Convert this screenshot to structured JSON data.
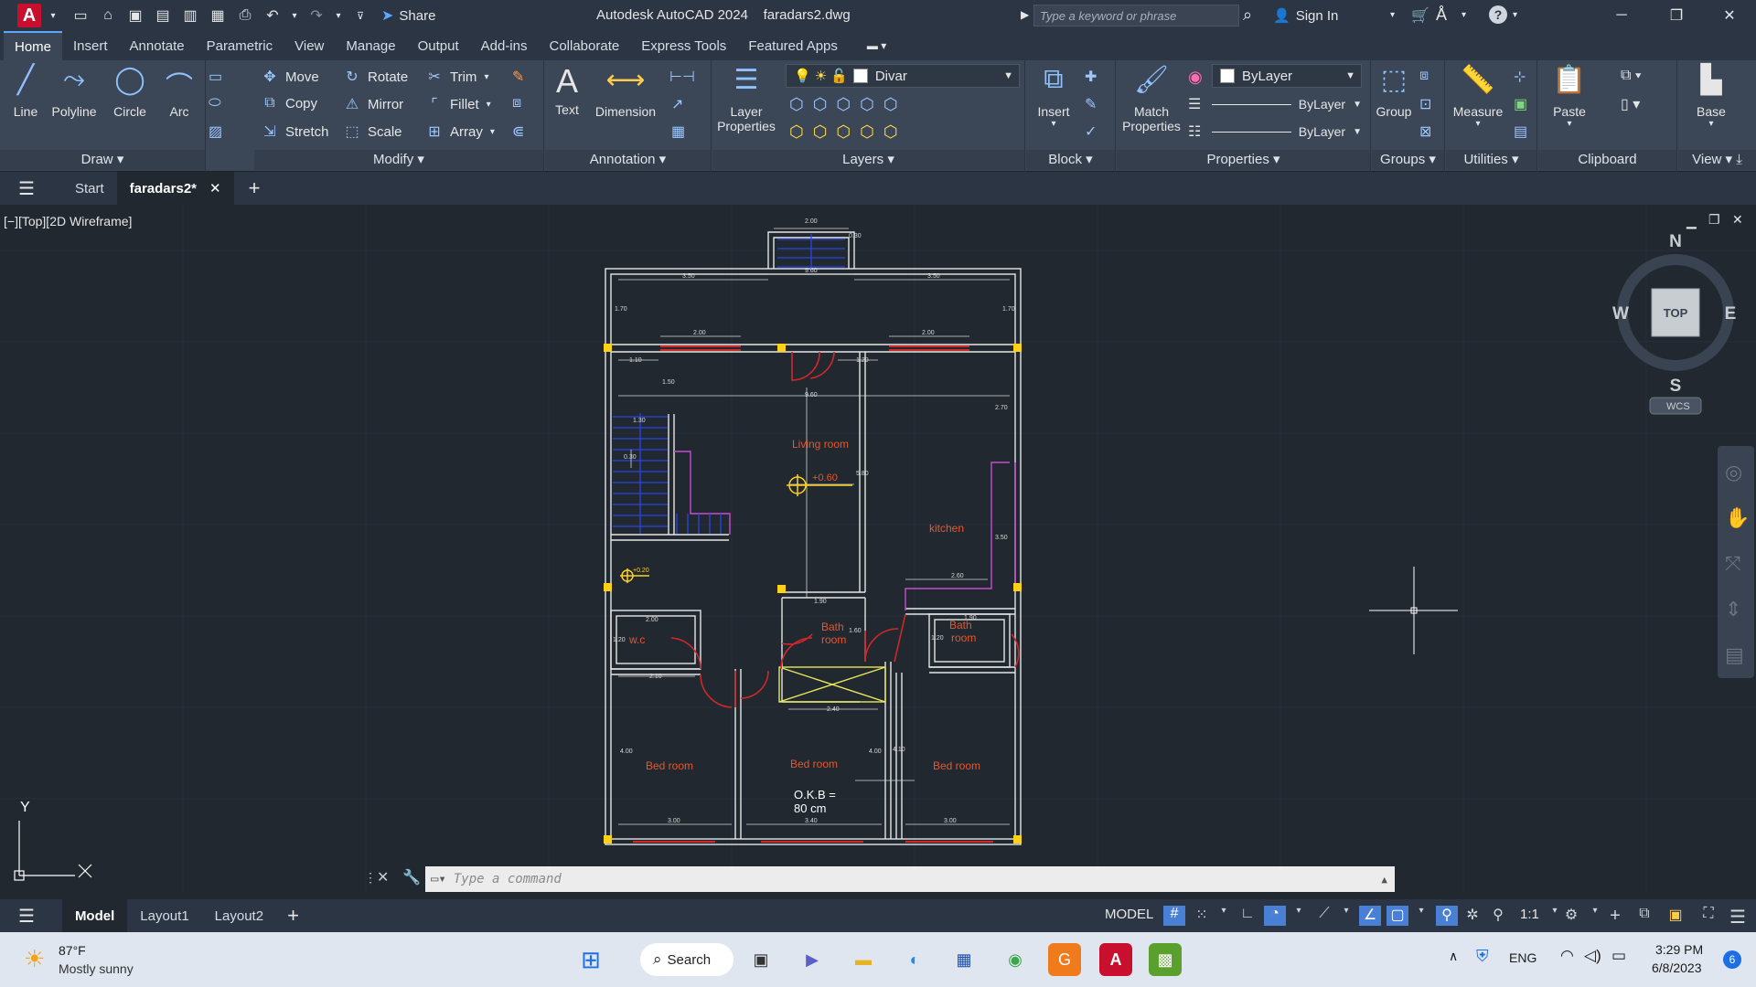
{
  "app": {
    "logo_letter": "A",
    "title": "Autodesk AutoCAD 2024",
    "filename": "faradars2.dwg",
    "share_label": "Share",
    "search_placeholder": "Type a keyword or phrase",
    "sign_in": "Sign In"
  },
  "menu_tabs": [
    "Home",
    "Insert",
    "Annotate",
    "Parametric",
    "View",
    "Manage",
    "Output",
    "Add-ins",
    "Collaborate",
    "Express Tools",
    "Featured Apps"
  ],
  "ribbon": {
    "draw": {
      "title": "Draw",
      "line": "Line",
      "polyline": "Polyline",
      "circle": "Circle",
      "arc": "Arc"
    },
    "modify": {
      "title": "Modify",
      "move": "Move",
      "rotate": "Rotate",
      "trim": "Trim",
      "copy": "Copy",
      "mirror": "Mirror",
      "fillet": "Fillet",
      "stretch": "Stretch",
      "scale": "Scale",
      "array": "Array"
    },
    "annotation": {
      "title": "Annotation",
      "text": "Text",
      "dimension": "Dimension"
    },
    "layers": {
      "title": "Layers",
      "layer_properties_1": "Layer",
      "layer_properties_2": "Properties",
      "current_layer": "Divar"
    },
    "block": {
      "title": "Block",
      "insert": "Insert"
    },
    "properties": {
      "title": "Properties",
      "match_1": "Match",
      "match_2": "Properties",
      "color": "ByLayer",
      "linetype": "ByLayer",
      "lineweight": "ByLayer"
    },
    "groups": {
      "title": "Groups",
      "group": "Group"
    },
    "utilities": {
      "title": "Utilities",
      "measure": "Measure"
    },
    "clipboard": {
      "title": "Clipboard",
      "paste": "Paste"
    },
    "view": {
      "title": "View",
      "base": "Base"
    }
  },
  "file_tabs": {
    "start": "Start",
    "active": "faradars2*"
  },
  "viewport": {
    "label": "[−][Top][2D Wireframe]",
    "viewcube": {
      "n": "N",
      "s": "S",
      "e": "E",
      "w": "W",
      "top": "TOP",
      "wcs": "WCS"
    },
    "ucs_y": "Y"
  },
  "drawing": {
    "rooms": {
      "living": "Living room",
      "kitchen": "kitchen",
      "bath1_a": "Bath",
      "bath1_b": "room",
      "bath2_a": "Bath",
      "bath2_b": "room",
      "wc": "w.c",
      "bed1": "Bed room",
      "bed2": "Bed room",
      "bed3": "Bed room"
    },
    "elevation": "+0.60",
    "elevation_small": "+0.20",
    "okb_1": "O.K.B =",
    "okb_2": "80 cm",
    "dims": {
      "top": "2.00",
      "top_r": "0.30",
      "d350a": "3.50",
      "d960a": "9.60",
      "d350b": "3.50",
      "d170a": "1.70",
      "d170b": "1.70",
      "d200a": "2.00",
      "d200b": "2.00",
      "d110": "1.10",
      "d120": "1.20",
      "d150": "1.50",
      "d960b": "9.60",
      "d270": "2.70",
      "d130": "1.30",
      "d030": "0.30",
      "d580": "5.80",
      "d350c": "3.50",
      "d260": "2.60",
      "d200c": "2.00",
      "d120b": "1.20",
      "d190a": "1.90",
      "d190b": "1.90",
      "d160": "1.60",
      "d120c": "1.20",
      "d210": "2.10",
      "d240": "2.40",
      "d400a": "4.00",
      "d400b": "4.00",
      "d410": "4.10",
      "d300a": "3.00",
      "d340": "3.40",
      "d300b": "3.00"
    }
  },
  "command": {
    "placeholder": "Type a command"
  },
  "layout_tabs": [
    "Model",
    "Layout1",
    "Layout2"
  ],
  "status": {
    "model": "MODEL",
    "scale": "1:1"
  },
  "taskbar": {
    "weather_temp": "87°F",
    "weather_desc": "Mostly sunny",
    "search": "Search",
    "lang": "ENG",
    "time": "3:29 PM",
    "date": "6/8/2023",
    "notif_count": "6"
  }
}
